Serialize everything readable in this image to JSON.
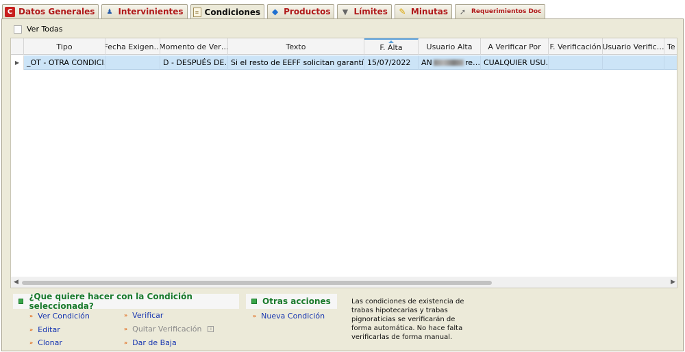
{
  "tabs": [
    {
      "label": "Datos Generales",
      "icon": "red-c-icon",
      "active": false
    },
    {
      "label": "Intervinientes",
      "icon": "person-icon",
      "active": false
    },
    {
      "label": "Condiciones",
      "icon": "document-icon",
      "active": true
    },
    {
      "label": "Productos",
      "icon": "cube-icon",
      "active": false
    },
    {
      "label": "Límites",
      "icon": "filter-icon",
      "active": false
    },
    {
      "label": "Minutas",
      "icon": "note-icon",
      "active": false
    },
    {
      "label": "Requerimientos Doc",
      "icon": "doc-arrow-icon",
      "active": false
    }
  ],
  "ver_todas": {
    "label": "Ver Todas",
    "checked": false
  },
  "grid": {
    "columns": [
      "Tipo",
      "Fecha Exigen…",
      "Momento de Ver…",
      "Texto",
      "F. Alta",
      "Usuario Alta",
      "A Verificar Por",
      "F. Verificación",
      "Usuario Verific…",
      "Te"
    ],
    "sorted_column": "F. Alta",
    "rows": [
      {
        "tipo": "_OT - OTRA CONDICI…",
        "fecha_exigencia": "",
        "momento": "D - DESPUÉS DE…",
        "texto": "Si el resto de EEFF solicitan garantías…",
        "f_alta": "15/07/2022",
        "usuario_alta_prefix": "AN",
        "usuario_alta_suffix": "re…",
        "verificar_por": "CUALQUIER USU…",
        "f_verificacion": "",
        "usuario_verific": "",
        "te": ""
      }
    ]
  },
  "actions": {
    "header": "¿Que quiere hacer con la Condición seleccionada?",
    "ver_condicion": "Ver Condición",
    "editar": "Editar",
    "clonar": "Clonar",
    "verificar": "Verificar",
    "quitar_verificacion": "Quitar Verificación",
    "dar_de_baja": "Dar de Baja"
  },
  "otras": {
    "header": "Otras acciones",
    "nueva_condicion": "Nueva Condición"
  },
  "note": "Las condiciones de existencia de trabas hipotecarias y trabas pignoraticias se verificarán de forma automática. No hace falta verificarlas de forma manual.",
  "colors": {
    "tab_text": "#b0191a",
    "selected_row": "#cce4f7",
    "action_header": "#1a7a2c",
    "link": "#1433b0",
    "panel": "#ecead9"
  }
}
